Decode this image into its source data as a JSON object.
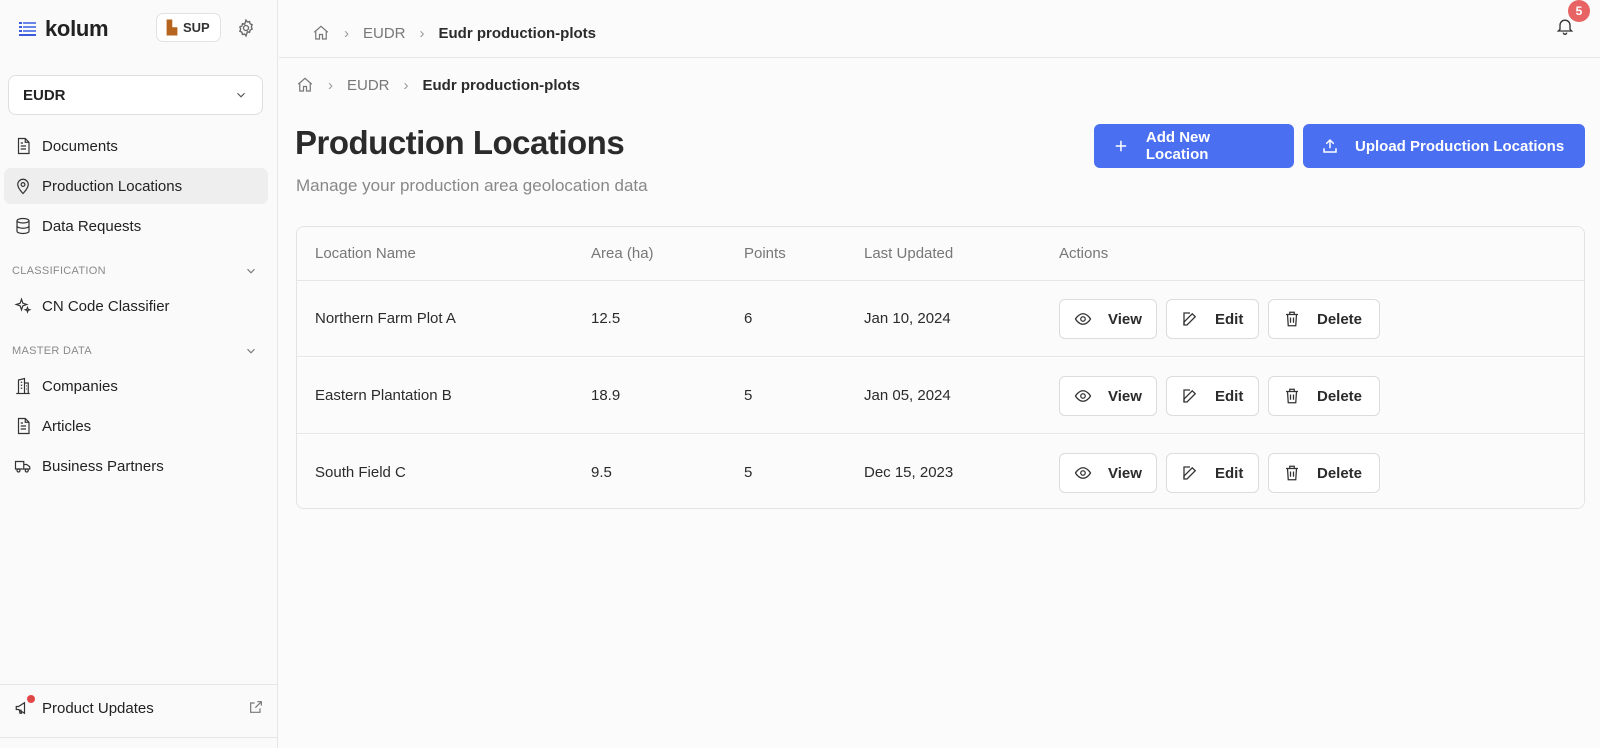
{
  "brand": {
    "name": "kolum",
    "org": "SUP"
  },
  "sidebar": {
    "selector": "EUDR",
    "items": [
      {
        "label": "Documents",
        "icon": "document-icon"
      },
      {
        "label": "Production Locations",
        "icon": "map-pin-icon",
        "active": true
      },
      {
        "label": "Data Requests",
        "icon": "database-icon"
      }
    ],
    "sections": [
      {
        "label": "CLASSIFICATION",
        "items": [
          {
            "label": "CN Code Classifier",
            "icon": "sparkles-icon"
          }
        ]
      },
      {
        "label": "MASTER DATA",
        "items": [
          {
            "label": "Companies",
            "icon": "building-icon"
          },
          {
            "label": "Articles",
            "icon": "document-icon"
          },
          {
            "label": "Business Partners",
            "icon": "truck-icon"
          }
        ]
      }
    ],
    "footer": {
      "label": "Product Updates"
    }
  },
  "topbar": {
    "breadcrumb": [
      "EUDR",
      "Eudr production-plots"
    ],
    "notifications": "5"
  },
  "main": {
    "breadcrumb": [
      "EUDR",
      "Eudr production-plots"
    ],
    "title": "Production Locations",
    "subtitle": "Manage your production area geolocation data",
    "add_button": "Add New Location",
    "upload_button": "Upload Production Locations",
    "table": {
      "columns": [
        "Location Name",
        "Area (ha)",
        "Points",
        "Last Updated",
        "Actions"
      ],
      "rows": [
        {
          "name": "Northern Farm Plot A",
          "area": "12.5",
          "points": "6",
          "updated": "Jan 10, 2024"
        },
        {
          "name": "Eastern Plantation B",
          "area": "18.9",
          "points": "5",
          "updated": "Jan 05, 2024"
        },
        {
          "name": "South Field C",
          "area": "9.5",
          "points": "5",
          "updated": "Dec 15, 2023"
        }
      ],
      "actions": {
        "view": "View",
        "edit": "Edit",
        "delete": "Delete"
      }
    }
  },
  "colors": {
    "primary": "#4a6ff0",
    "badge": "#e86464",
    "active_bg": "#eeeeee"
  }
}
